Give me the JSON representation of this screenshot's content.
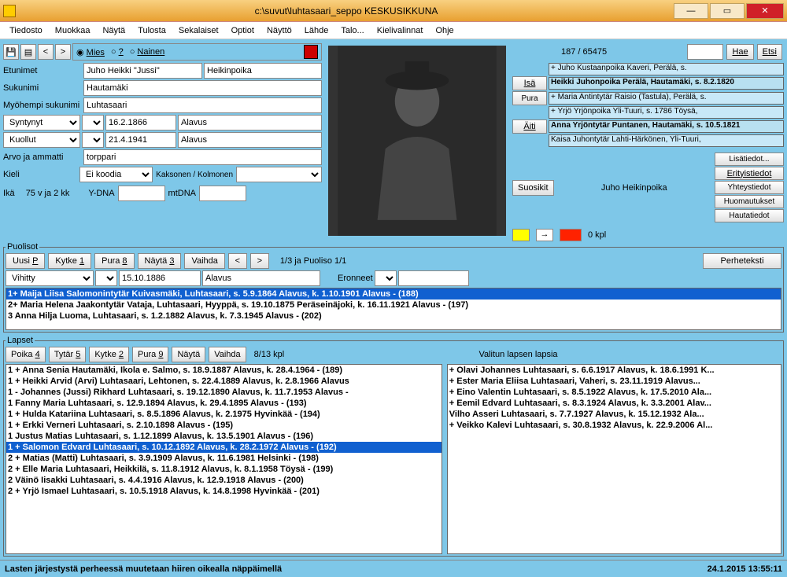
{
  "title": "c:\\suvut\\luhtasaari_seppo                  KESKUSIKKUNA",
  "menu": [
    "Tiedosto",
    "Muokkaa",
    "Näytä",
    "Tulosta",
    "Sekalaiset",
    "Optiot",
    "Näyttö",
    "Lähde",
    "Talo...",
    "Kielivalinnat",
    "Ohje"
  ],
  "gender": {
    "mies": "Mies",
    "q": "?",
    "nainen": "Nainen"
  },
  "labels": {
    "etunimet": "Etunimet",
    "sukunimi": "Sukunimi",
    "myoh": "Myöhempi sukunimi",
    "syntynyt": "Syntynyt",
    "kuollut": "Kuollut",
    "arvo": "Arvo ja ammatti",
    "kieli": "Kieli",
    "kaks": "Kaksonen / Kolmonen",
    "ika": "Ikä",
    "ydna": "Y-DNA",
    "mtdna": "mtDNA",
    "hae": "Hae",
    "etsi": "Etsi",
    "isa": "Isä",
    "pura": "Pura",
    "aiti": "Äiti",
    "suosikit": "Suosikit",
    "lisatiedot": "Lisätiedot...",
    "erityis": "Erityistiedot",
    "yhteys": "Yhteystiedot",
    "huom": "Huomautukset",
    "hauta": "Hautatiedot",
    "puolisot": "Puolisot",
    "uusiP": "Uusi P",
    "kytke1": "Kytke 1",
    "pura8": "Pura 8",
    "nayta3": "Näytä 3",
    "vaihda": "Vaihda",
    "perheteksti": "Perheteksti",
    "vihitty": "Vihitty",
    "eronneet": "Eronneet",
    "lapset": "Lapset",
    "poika4": "Poika 4",
    "tytar5": "Tytär 5",
    "kytke2": "Kytke 2",
    "pura9": "Pura 9",
    "nayta": "Näytä",
    "valitun": "Valitun lapsen lapsia",
    "kpl": "0 kpl"
  },
  "person": {
    "etunimet": "Juho Heikki \"Jussi\"",
    "patronym": "Heikinpoika",
    "sukunimi": "Hautamäki",
    "myoh": "Luhtasaari",
    "synt_date": "16.2.1866",
    "synt_place": "Alavus",
    "kuol_date": "21.4.1941",
    "kuol_place": "Alavus",
    "arvo": "torppari",
    "kieli": "Ei koodia",
    "ika": "75 v ja 2 kk",
    "name_display": "Juho Heikinpoika"
  },
  "right": {
    "counter": "187 / 65475",
    "parents": [
      "+ Juho Kustaanpoika Kaveri, Perälä,  s.",
      "Heikki Juhonpoika Perälä, Hautamäki,  s.  8.2.1820",
      "+ Maria Antintytär Raisio (Tastula), Perälä,  s.",
      "+ Yrjö Yrjönpoika Yli-Tuuri,  s. 1786 Töysä,",
      "Anna Yrjöntytär Puntanen, Hautamäki,  s.  10.5.1821",
      "Kaisa Juhontytär Lahti-Härkönen, Yli-Tuuri,"
    ]
  },
  "spouses": {
    "counter": "1/3 ja Puoliso 1/1",
    "vihitty_date": "15.10.1886",
    "vihitty_place": "Alavus",
    "items": [
      "1+ Maija Liisa Salomonintytär Kuivasmäki, Luhtasaari,  s. 5.9.1864 Alavus, k. 1.10.1901 Alavus - (188)",
      "2+ Maria Helena Jaakontytär Vataja, Luhtasaari, Hyyppä,  s. 19.10.1875 Peräseinäjoki, k. 16.11.1921 Alavus - (197)",
      "3  Anna Hilja Luoma, Luhtasaari,  s. 1.2.1882 Alavus, k. 7.3.1945 Alavus - (202)"
    ],
    "selected": 0
  },
  "children": {
    "count": "8/13 kpl",
    "items": [
      "1 + Anna Senia Hautamäki, Ikola e. Salmo,  s. 18.9.1887 Alavus, k. 28.4.1964 - (189)",
      "1 + Heikki Arvid (Arvi) Luhtasaari, Lehtonen,  s. 22.4.1889 Alavus, k. 2.8.1966 Alavus",
      "1 -  Johannes (Jussi) Rikhard Luhtasaari,  s. 19.12.1890 Alavus, k. 11.7.1953 Alavus -",
      "1    Fanny Maria Luhtasaari,  s. 12.9.1894 Alavus, k. 29.4.1895 Alavus - (193)",
      "1 + Hulda Katariina Luhtasaari,  s. 8.5.1896 Alavus, k. 2.1975 Hyvinkää - (194)",
      "1 + Erkki Verneri Luhtasaari,  s. 2.10.1898 Alavus - (195)",
      "1    Justus Matias Luhtasaari,  s. 1.12.1899 Alavus, k. 13.5.1901 Alavus - (196)",
      "1 + Salomon Edvard Luhtasaari,  s. 10.12.1892 Alavus, k. 28.2.1972 Alavus - (192)",
      "2 + Matias (Matti) Luhtasaari,  s. 3.9.1909 Alavus, k. 11.6.1981 Helsinki - (198)",
      "2 + Elle Maria Luhtasaari, Heikkilä,  s. 11.8.1912 Alavus, k. 8.1.1958 Töysä - (199)",
      "2    Väinö Iisakki Luhtasaari,  s. 4.4.1916 Alavus, k. 12.9.1918 Alavus - (200)",
      "2 + Yrjö Ismael Luhtasaari,  s. 10.5.1918 Alavus, k. 14.8.1998 Hyvinkää - (201)"
    ],
    "selected": 7,
    "grandchildren": [
      "+ Olavi Johannes Luhtasaari,  s. 6.6.1917 Alavus, k. 18.6.1991 K...",
      "+ Ester Maria Eliisa Luhtasaari, Vaheri,  s. 23.11.1919 Alavus...",
      "+ Eino Valentin Luhtasaari,  s. 8.5.1922 Alavus, k. 17.5.2010 Ala...",
      "+ Eemil Edvard Luhtasaari,  s. 8.3.1924 Alavus, k. 3.3.2001 Alav...",
      "   Vilho Asseri Luhtasaari,  s. 7.7.1927 Alavus, k. 15.12.1932 Ala...",
      "+ Veikko Kalevi Luhtasaari,  s. 30.8.1932 Alavus, k. 22.9.2006 Al..."
    ]
  },
  "status": {
    "hint": "Lasten järjestystä perheessä muutetaan hiiren oikealla näppäimellä",
    "datetime": "24.1.2015 13:55:11"
  }
}
